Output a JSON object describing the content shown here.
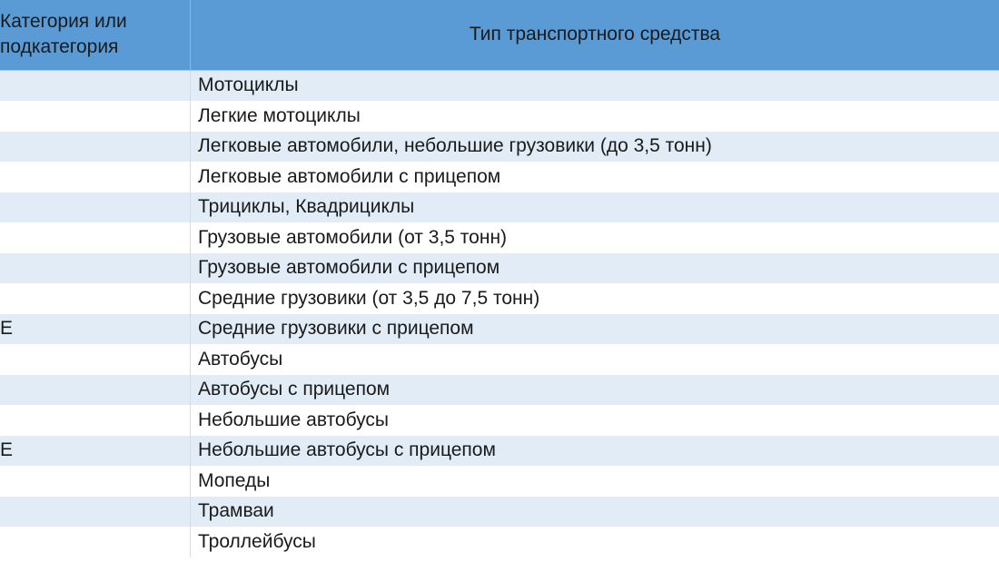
{
  "table": {
    "header": {
      "col1": "Категория или подкатегория",
      "col2": "Тип транспортного средства"
    },
    "rows": [
      {
        "category": "",
        "vehicle": "Мотоциклы"
      },
      {
        "category": "",
        "vehicle": "Легкие мотоциклы"
      },
      {
        "category": "",
        "vehicle": "Легковые автомобили, небольшие грузовики (до 3,5 тонн)"
      },
      {
        "category": "",
        "vehicle": "Легковые автомобили с прицепом"
      },
      {
        "category": "",
        "vehicle": "Трициклы, Квадрициклы"
      },
      {
        "category": "",
        "vehicle": "Грузовые автомобили (от 3,5 тонн)"
      },
      {
        "category": "",
        "vehicle": "Грузовые автомобили с прицепом"
      },
      {
        "category": "",
        "vehicle": "Средние грузовики (от 3,5 до 7,5 тонн)"
      },
      {
        "category": "E",
        "vehicle": "Средние грузовики с прицепом"
      },
      {
        "category": "",
        "vehicle": "Автобусы"
      },
      {
        "category": "",
        "vehicle": "Автобусы с прицепом"
      },
      {
        "category": "",
        "vehicle": "Небольшие автобусы"
      },
      {
        "category": "E",
        "vehicle": "Небольшие автобусы с прицепом"
      },
      {
        "category": "",
        "vehicle": "Мопеды"
      },
      {
        "category": "",
        "vehicle": "Трамваи"
      },
      {
        "category": "",
        "vehicle": "Троллейбусы"
      }
    ]
  }
}
